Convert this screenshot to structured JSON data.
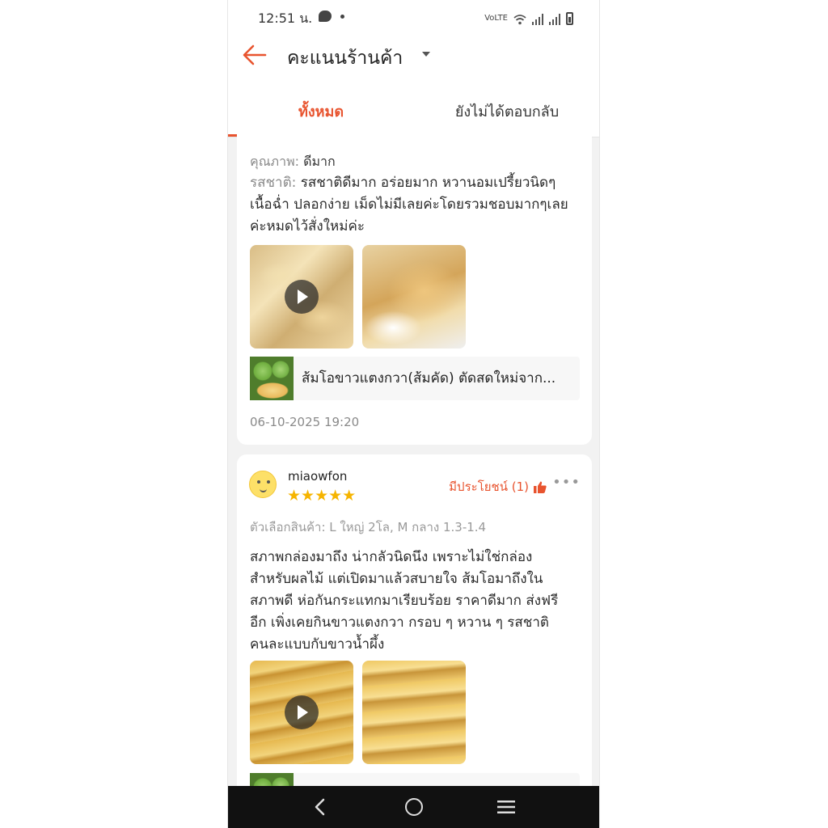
{
  "status_bar": {
    "time": "12:51 น.",
    "vo_text": "VoLTE"
  },
  "header": {
    "title": "คะแนนร้านค้า"
  },
  "tabs": [
    {
      "label": "ทั้งหมด",
      "active": true
    },
    {
      "label": "ยังไม่ได้ตอบกลับ",
      "active": false
    }
  ],
  "review1": {
    "quality_label": "คุณภาพ:",
    "quality_value": "ดีมาก",
    "taste_label": "รสชาติ:",
    "taste_line1": "รสชาติดีมาก อร่อยมาก หวานอมเปรี้ยวนิดๆ",
    "taste_line2": "เนื้อฉ่ำ ปลอกง่าย เม็ดไม่มีเลยค่ะโดยรวมชอบมากๆเลย",
    "taste_line3": "ค่ะหมดไว้สั่งใหม่ค่ะ",
    "product_name": "ส้มโอขาวแตงกวา(ส้มคัด) ตัดสดใหม่จาก...",
    "date": "06-10-2025 19:20"
  },
  "review2": {
    "username": "miaowfon",
    "rating": 5,
    "stars": "★★★★★",
    "helpful_text": "มีประโยชน์ (1)",
    "more_text": "•••",
    "variant": "ตัวเลือกสินค้า: L ใหญ่ 2โล, M กลาง 1.3-1.4",
    "body_lines": [
      "สภาพกล่องมาถึง น่ากลัวนิดนึง เพราะไม่ใช่กล่อง",
      "สำหรับผลไม้ แต่เปิดมาแล้วสบายใจ ส้มโอมาถึงใน",
      "สภาพดี ห่อกันกระแทกมาเรียบร้อย ราคาดีมาก ส่งฟรี",
      "อีก เพิ่งเคยกินขาวแตงกวา กรอบ ๆ หวาน ๆ รสชาติ",
      "คนละแบบกับขาวน้ำผึ้ง"
    ]
  },
  "colors": {
    "accent": "#e8542f",
    "star": "#f6b400",
    "navbar": "#111111"
  }
}
